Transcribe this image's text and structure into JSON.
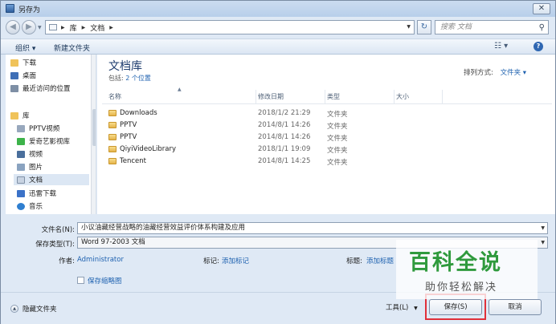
{
  "window": {
    "title": "另存为",
    "close_glyph": "✕"
  },
  "address": {
    "crumbs": [
      "库",
      "文档"
    ],
    "search_placeholder": "搜索 文档",
    "back_glyph": "◀",
    "forward_glyph": "▶",
    "refresh_glyph": "↻"
  },
  "toolbar": {
    "organize": "组织 ▾",
    "new_folder": "新建文件夹",
    "view_icon": "view-icon",
    "help": "?"
  },
  "sidebar": {
    "items": [
      {
        "label": "下载",
        "icon": "download-folder-icon",
        "color": "#f0c35a"
      },
      {
        "label": "桌面",
        "icon": "desktop-icon",
        "color": "#3f6fb6"
      },
      {
        "label": "最近访问的位置",
        "icon": "recent-places-icon",
        "color": "#7e8fa5"
      },
      {
        "label": "库",
        "icon": "library-icon",
        "color": "#f0c35a"
      },
      {
        "label": "PPTV视频",
        "icon": "video-library-icon",
        "color": "#98a8bd"
      },
      {
        "label": "爱奇艺影视库",
        "icon": "iqiyi-library-icon",
        "color": "#3db34a"
      },
      {
        "label": "视频",
        "icon": "videos-icon",
        "color": "#4a6f9c"
      },
      {
        "label": "图片",
        "icon": "pictures-icon",
        "color": "#8aa3c0"
      },
      {
        "label": "文档",
        "icon": "documents-icon",
        "color": "#c8d3e2"
      },
      {
        "label": "迅雷下载",
        "icon": "thunder-download-icon",
        "color": "#3b72c8"
      },
      {
        "label": "音乐",
        "icon": "music-icon",
        "color": "#2f7fd0"
      }
    ]
  },
  "library": {
    "title": "文档库",
    "includes_label": "包括:",
    "includes_link": "2 个位置",
    "arrange_label": "排列方式:",
    "arrange_value": "文件夹 ▾"
  },
  "columns": [
    "名称",
    "修改日期",
    "类型",
    "大小"
  ],
  "files": [
    {
      "name": "Downloads",
      "date": "2018/1/2 21:29",
      "type": "文件夹"
    },
    {
      "name": "PPTV",
      "date": "2014/8/1 14:26",
      "type": "文件夹"
    },
    {
      "name": "PPTV",
      "date": "2014/8/1 14:26",
      "type": "文件夹"
    },
    {
      "name": "QiyiVideoLibrary",
      "date": "2018/1/1 19:09",
      "type": "文件夹"
    },
    {
      "name": "Tencent",
      "date": "2014/8/1 14:25",
      "type": "文件夹"
    }
  ],
  "form": {
    "filename_label": "文件名(N):",
    "filename_value": "小议油藏经营战略的油藏经营效益评价体系构建及应用",
    "type_label": "保存类型(T):",
    "type_value": "Word 97-2003 文档",
    "author_label": "作者:",
    "author_value": "Administrator",
    "tags_label": "标记:",
    "tags_value": "添加标记",
    "title_label": "标题:",
    "title_value": "添加标题",
    "thumbnail_label": "保存缩略图",
    "hide_folders": "隐藏文件夹",
    "tools": "工具(L)",
    "save": "保存(S)",
    "cancel": "取消"
  },
  "watermark": {
    "main": "百科全说",
    "sub": "助你轻松解决"
  },
  "colors": {
    "accent_link": "#1f62b0",
    "highlight_box": "#e0303a",
    "watermark_green": "#2f9a3d"
  }
}
